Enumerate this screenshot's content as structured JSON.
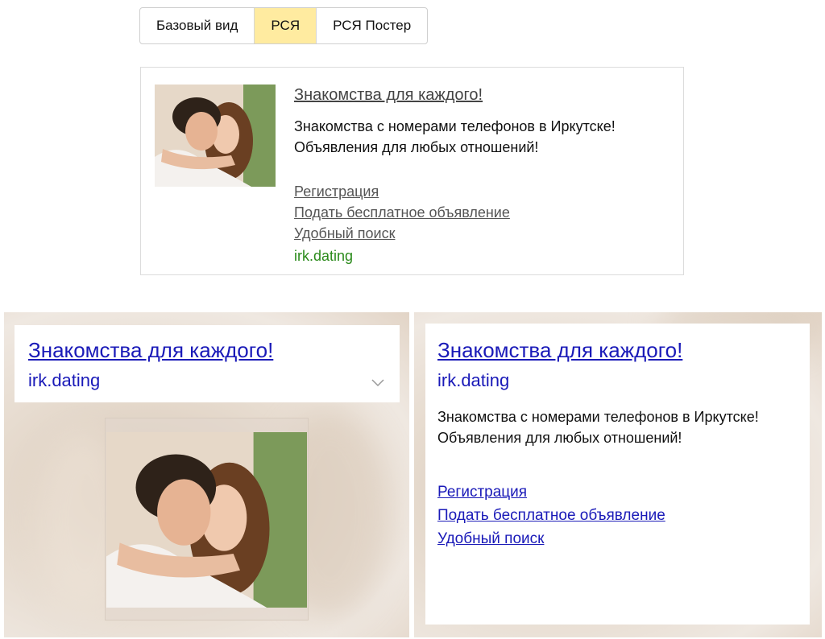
{
  "tabs": [
    {
      "label": "Базовый вид",
      "active": false
    },
    {
      "label": "РСЯ",
      "active": true
    },
    {
      "label": "РСЯ Постер",
      "active": false
    }
  ],
  "ad": {
    "title": "Знакомства для каждого!",
    "text": "Знакомства с номерами телефонов в Иркутске! Объявления для любых отношений!",
    "links": [
      "Регистрация",
      "Подать бесплатное объявление",
      "Удобный поиск"
    ],
    "domain": "irk.dating"
  },
  "poster_left": {
    "title": "Знакомства для каждого!",
    "domain": "irk.dating",
    "expand_icon": "chevron-down-icon"
  },
  "poster_right": {
    "title": "Знакомства для каждого!",
    "domain": "irk.dating",
    "text": "Знакомства с номерами телефонов в Иркутске! Объявления для любых отношений!",
    "links": [
      "Регистрация",
      "Подать бесплатное объявление",
      "Удобный поиск"
    ]
  },
  "colors": {
    "active_tab": "#ffeba0",
    "link_blue": "#1a1ab8",
    "domain_green": "#2a8a1a"
  }
}
